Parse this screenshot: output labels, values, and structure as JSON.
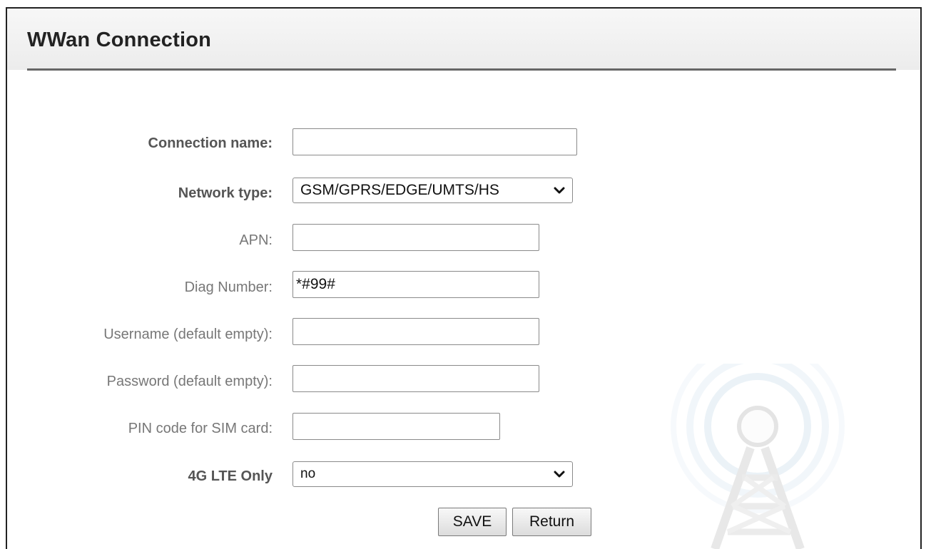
{
  "page": {
    "title": "WWan Connection"
  },
  "form": {
    "connection_name": {
      "label": "Connection name:",
      "value": ""
    },
    "network_type": {
      "label": "Network type:",
      "selected": "GSM/GPRS/EDGE/UMTS/HS"
    },
    "apn": {
      "label": "APN:",
      "value": ""
    },
    "diag_number": {
      "label": "Diag Number:",
      "value": "*#99#"
    },
    "username": {
      "label": "Username (default empty):",
      "value": ""
    },
    "password": {
      "label": "Password (default empty):",
      "value": ""
    },
    "pin_code": {
      "label": "PIN code for SIM card:",
      "value": ""
    },
    "lte_only": {
      "label": "4G LTE Only",
      "selected": "no"
    }
  },
  "actions": {
    "save_label": "SAVE",
    "return_label": "Return"
  },
  "icons": {
    "select_arrow": "chevron-down-icon",
    "watermark": "radio-tower-icon"
  }
}
